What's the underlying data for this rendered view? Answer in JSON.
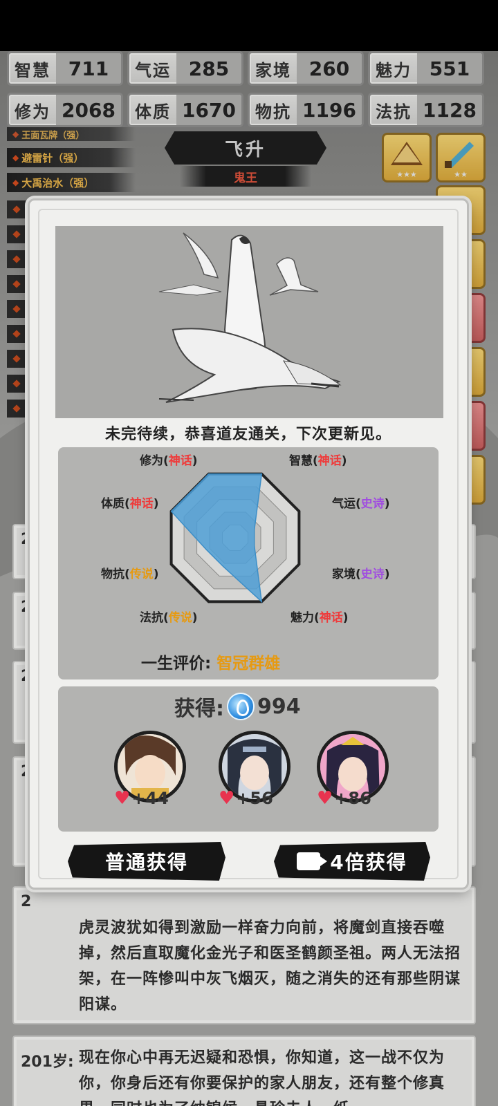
{
  "stats_row1": [
    {
      "name": "智慧",
      "value": "711"
    },
    {
      "name": "气运",
      "value": "285"
    },
    {
      "name": "家境",
      "value": "260"
    },
    {
      "name": "魅力",
      "value": "551"
    }
  ],
  "stats_row2": [
    {
      "name": "修为",
      "value": "2068"
    },
    {
      "name": "体质",
      "value": "1670"
    },
    {
      "name": "物抗",
      "value": "1196"
    },
    {
      "name": "法抗",
      "value": "1128"
    }
  ],
  "skills": [
    "王面瓦牌（强）",
    "避雷针（强）",
    "大禹治水（强）"
  ],
  "realm": {
    "title": "飞升",
    "subtitle": "鬼王"
  },
  "equipment": {
    "stars_a": "★★★",
    "stars_b": "★★"
  },
  "modal": {
    "result_text": "未完待续，恭喜道友通关，下次更新见。",
    "radar": {
      "axes": [
        {
          "name": "修为",
          "quality": "神话",
          "tier": "myth"
        },
        {
          "name": "智慧",
          "quality": "神话",
          "tier": "myth"
        },
        {
          "name": "气运",
          "quality": "史诗",
          "tier": "epic"
        },
        {
          "name": "家境",
          "quality": "史诗",
          "tier": "epic"
        },
        {
          "name": "魅力",
          "quality": "神话",
          "tier": "myth"
        },
        {
          "name": "法抗",
          "quality": "传说",
          "tier": "legend"
        },
        {
          "name": "物抗",
          "quality": "传说",
          "tier": "legend"
        },
        {
          "name": "体质",
          "quality": "神话",
          "tier": "myth"
        }
      ]
    },
    "evaluation": {
      "label": "一生评价:",
      "value": "智冠群雄"
    },
    "gain": {
      "label": "获得:",
      "amount": "994"
    },
    "companions": [
      {
        "affection": "+44"
      },
      {
        "affection": "+56"
      },
      {
        "affection": "+86"
      }
    ],
    "buttons": {
      "normal": "普通获得",
      "video": "4倍获得"
    }
  },
  "log_cards": [
    {
      "age": "2"
    },
    {
      "age": "2"
    },
    {
      "age": "2"
    },
    {
      "age": "2"
    },
    {
      "age": "2",
      "text": "虎灵波犹如得到激励一样奋力向前，将魔剑直接吞噬掉，然后直取魔化金光子和医圣鹤颜圣祖。两人无法招架，在一阵惨叫中灰飞烟灭，随之消失的还有那些阴谋阳谋。"
    },
    {
      "age": "201岁:",
      "text": "现在你心中再无迟疑和恐惧，你知道，这一战不仅为你，你身后还有你要保护的家人朋友，还有整个修真界，同时也为了纳锦候，悬珍夫人，纸"
    }
  ]
}
